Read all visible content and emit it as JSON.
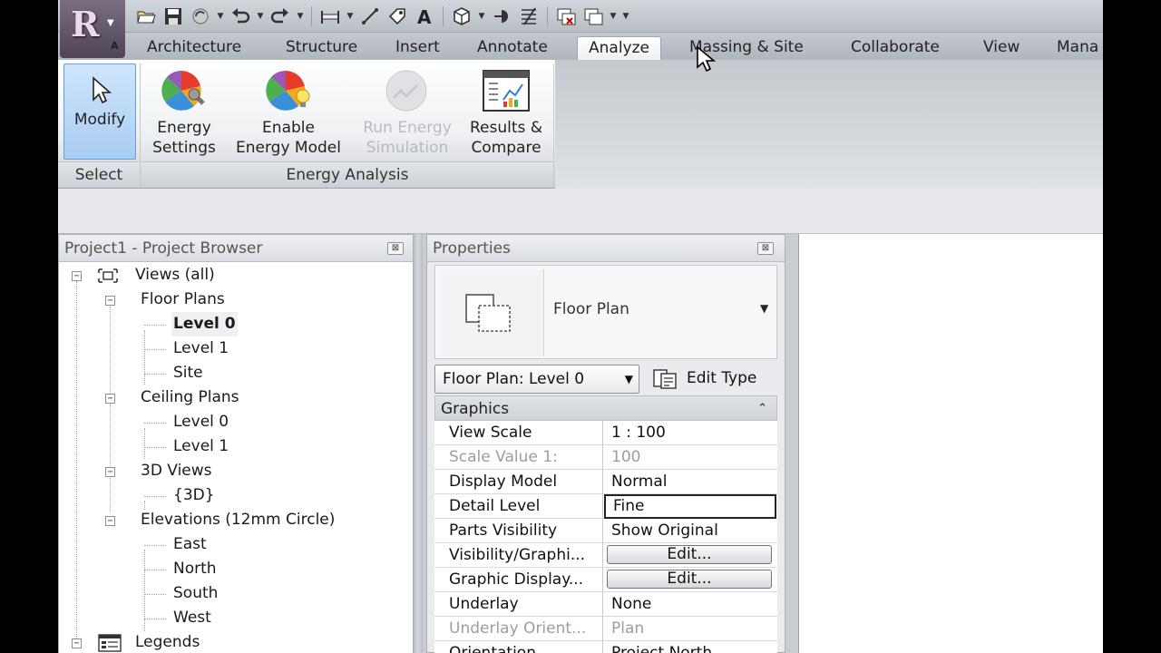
{
  "app": {
    "logo_letter": "R",
    "logo_sub": "A"
  },
  "ribbon_tabs": [
    {
      "label": "Architecture"
    },
    {
      "label": "Structure"
    },
    {
      "label": "Insert"
    },
    {
      "label": "Annotate"
    },
    {
      "label": "Analyze"
    },
    {
      "label": "Massing & Site"
    },
    {
      "label": "Collaborate"
    },
    {
      "label": "View"
    },
    {
      "label": "Mana"
    }
  ],
  "active_tab": "Analyze",
  "ribbon": {
    "modify": {
      "label": "Modify"
    },
    "energy_settings": {
      "line1": "Energy",
      "line2": "Settings"
    },
    "enable_energy_model": {
      "line1": "Enable",
      "line2": "Energy Model"
    },
    "run_energy_simulation": {
      "line1": "Run Energy",
      "line2": "Simulation"
    },
    "results_compare": {
      "line1": "Results &",
      "line2": "Compare"
    },
    "panels": {
      "select": "Select",
      "energy_analysis": "Energy Analysis"
    }
  },
  "project_browser": {
    "title": "Project1 - Project Browser",
    "close_glyph": "⊠",
    "nodes": [
      {
        "label": "Views (all)"
      },
      {
        "label": "Floor Plans"
      },
      {
        "label": "Level 0"
      },
      {
        "label": "Level 1"
      },
      {
        "label": "Site"
      },
      {
        "label": "Ceiling Plans"
      },
      {
        "label": "Level 0"
      },
      {
        "label": "Level 1"
      },
      {
        "label": "3D Views"
      },
      {
        "label": "{3D}"
      },
      {
        "label": "Elevations (12mm Circle)"
      },
      {
        "label": "East"
      },
      {
        "label": "North"
      },
      {
        "label": "South"
      },
      {
        "label": "West"
      },
      {
        "label": "Legends"
      }
    ],
    "toggle_glyph": "−"
  },
  "properties": {
    "title": "Properties",
    "close_glyph": "⊠",
    "type_name": "Floor Plan",
    "view_selector": "Floor Plan: Level 0",
    "edit_type": "Edit Type",
    "group": "Graphics",
    "rows": [
      {
        "key": "View Scale",
        "value": "1 : 100"
      },
      {
        "key": "Scale Value    1:",
        "value": "100"
      },
      {
        "key": "Display Model",
        "value": "Normal"
      },
      {
        "key": "Detail Level",
        "value": "Fine"
      },
      {
        "key": "Parts Visibility",
        "value": "Show Original"
      },
      {
        "key": "Visibility/Graphi...",
        "value": "Edit..."
      },
      {
        "key": "Graphic Display...",
        "value": "Edit..."
      },
      {
        "key": "Underlay",
        "value": "None"
      },
      {
        "key": "Underlay Orient...",
        "value": "Plan"
      },
      {
        "key": "Orientation",
        "value": "Project North"
      }
    ]
  }
}
